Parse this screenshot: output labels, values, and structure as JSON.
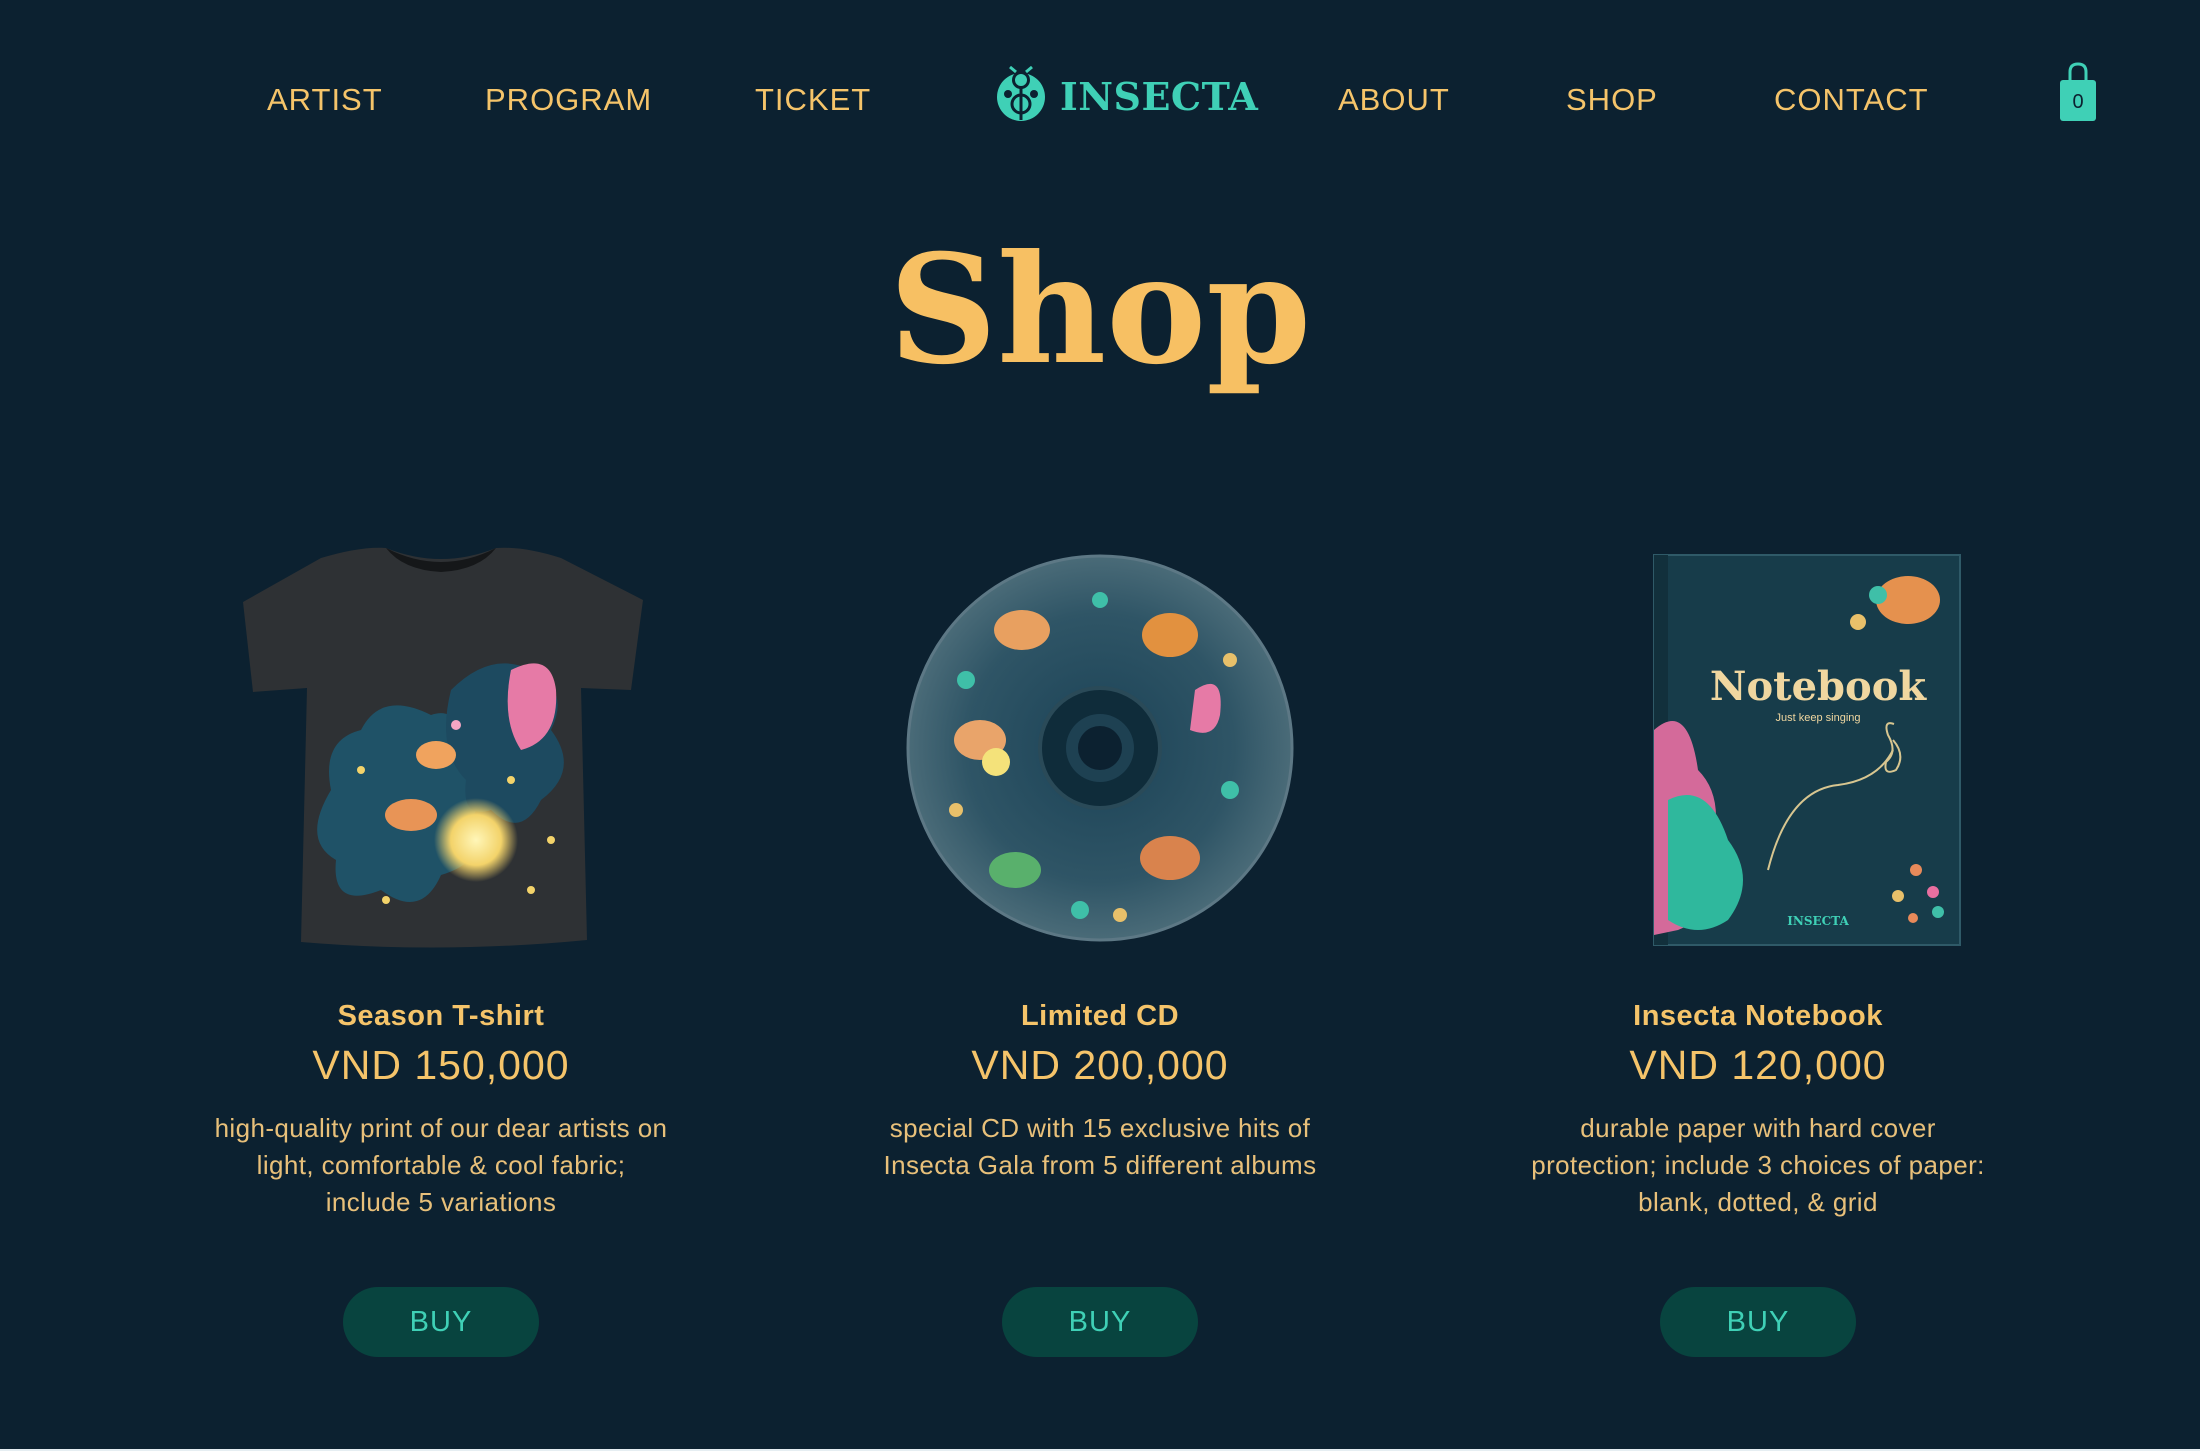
{
  "nav": {
    "left_links": [
      "ARTIST",
      "PROGRAM",
      "TICKET"
    ],
    "right_links": [
      "ABOUT",
      "SHOP",
      "CONTACT"
    ],
    "logo_text": "INSECTA",
    "logo_icon": "beetle-icon",
    "cart_icon": "shopping-bag-icon",
    "cart_count": "0"
  },
  "page": {
    "title": "Shop"
  },
  "products": [
    {
      "name": "Season T-shirt",
      "price": "VND 150,000",
      "description_lines": [
        "high-quality print of our dear artists on",
        "light, comfortable & cool fabric;",
        "include 5 variations"
      ],
      "buy_label": "BUY",
      "image": "tshirt-image"
    },
    {
      "name": "Limited CD",
      "price": "VND 200,000",
      "description_lines": [
        "special CD with 15 exclusive hits of",
        "Insecta Gala from 5 different albums"
      ],
      "buy_label": "BUY",
      "image": "cd-image"
    },
    {
      "name": "Insecta Notebook",
      "price": "VND 120,000",
      "description_lines": [
        "durable paper with hard cover",
        "protection; include 3 choices of paper:",
        "blank, dotted, & grid"
      ],
      "buy_label": "BUY",
      "image": "notebook-image",
      "cover_title": "Notebook",
      "cover_subtitle": "Just keep singing",
      "cover_brand": "INSECTA"
    }
  ],
  "colors": {
    "background": "#0c2130",
    "accent_gold": "#f5c46a",
    "accent_teal": "#3fd0b6",
    "button_bg": "#08443f"
  }
}
